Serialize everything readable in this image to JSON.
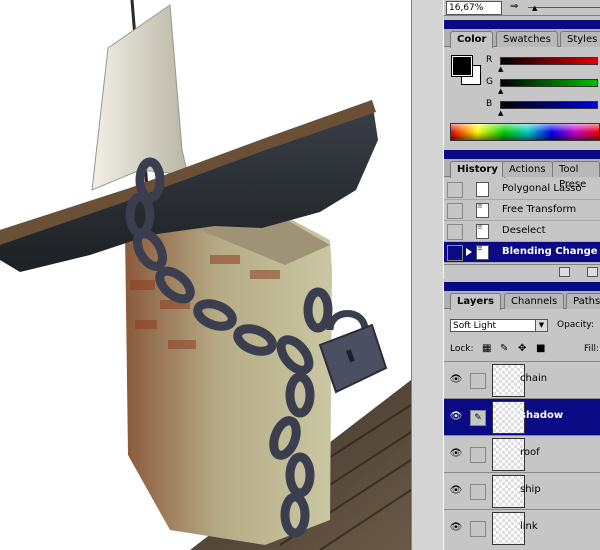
{
  "navigator": {
    "zoom": "16,67%",
    "zoom_out_icon": "zoom-out-icon"
  },
  "color_palette": {
    "tabs": [
      "Color",
      "Swatches",
      "Styles"
    ],
    "active_tab": "Color",
    "foreground": "#000000",
    "background": "#ffffff",
    "channels": [
      {
        "label": "R",
        "value": 0,
        "color": "#e00000"
      },
      {
        "label": "G",
        "value": 0,
        "color": "#00c000"
      },
      {
        "label": "B",
        "value": 0,
        "color": "#0000e0"
      }
    ]
  },
  "history_palette": {
    "tabs": [
      "History",
      "Actions",
      "Tool Prese"
    ],
    "active_tab": "History",
    "items": [
      {
        "label": "Polygonal Lasso",
        "selected": false
      },
      {
        "label": "Free Transform",
        "selected": false
      },
      {
        "label": "Deselect",
        "selected": false
      },
      {
        "label": "Blending Change",
        "selected": true
      }
    ]
  },
  "layers_palette": {
    "tabs": [
      "Layers",
      "Channels",
      "Paths"
    ],
    "active_tab": "Layers",
    "blend_mode": "Soft Light",
    "opacity_label": "Opacity:",
    "lock_label": "Lock:",
    "fill_label": "Fill:",
    "layers": [
      {
        "name": "chain",
        "visible": true,
        "selected": false
      },
      {
        "name": "shadow",
        "visible": true,
        "selected": true
      },
      {
        "name": "roof",
        "visible": true,
        "selected": false
      },
      {
        "name": "ship",
        "visible": true,
        "selected": false
      },
      {
        "name": "link",
        "visible": true,
        "selected": false
      }
    ]
  },
  "colors": {
    "palette_titlebar": "#0a0a84",
    "selection": "#0a0a84",
    "panel_bg": "#c6c6c6"
  }
}
